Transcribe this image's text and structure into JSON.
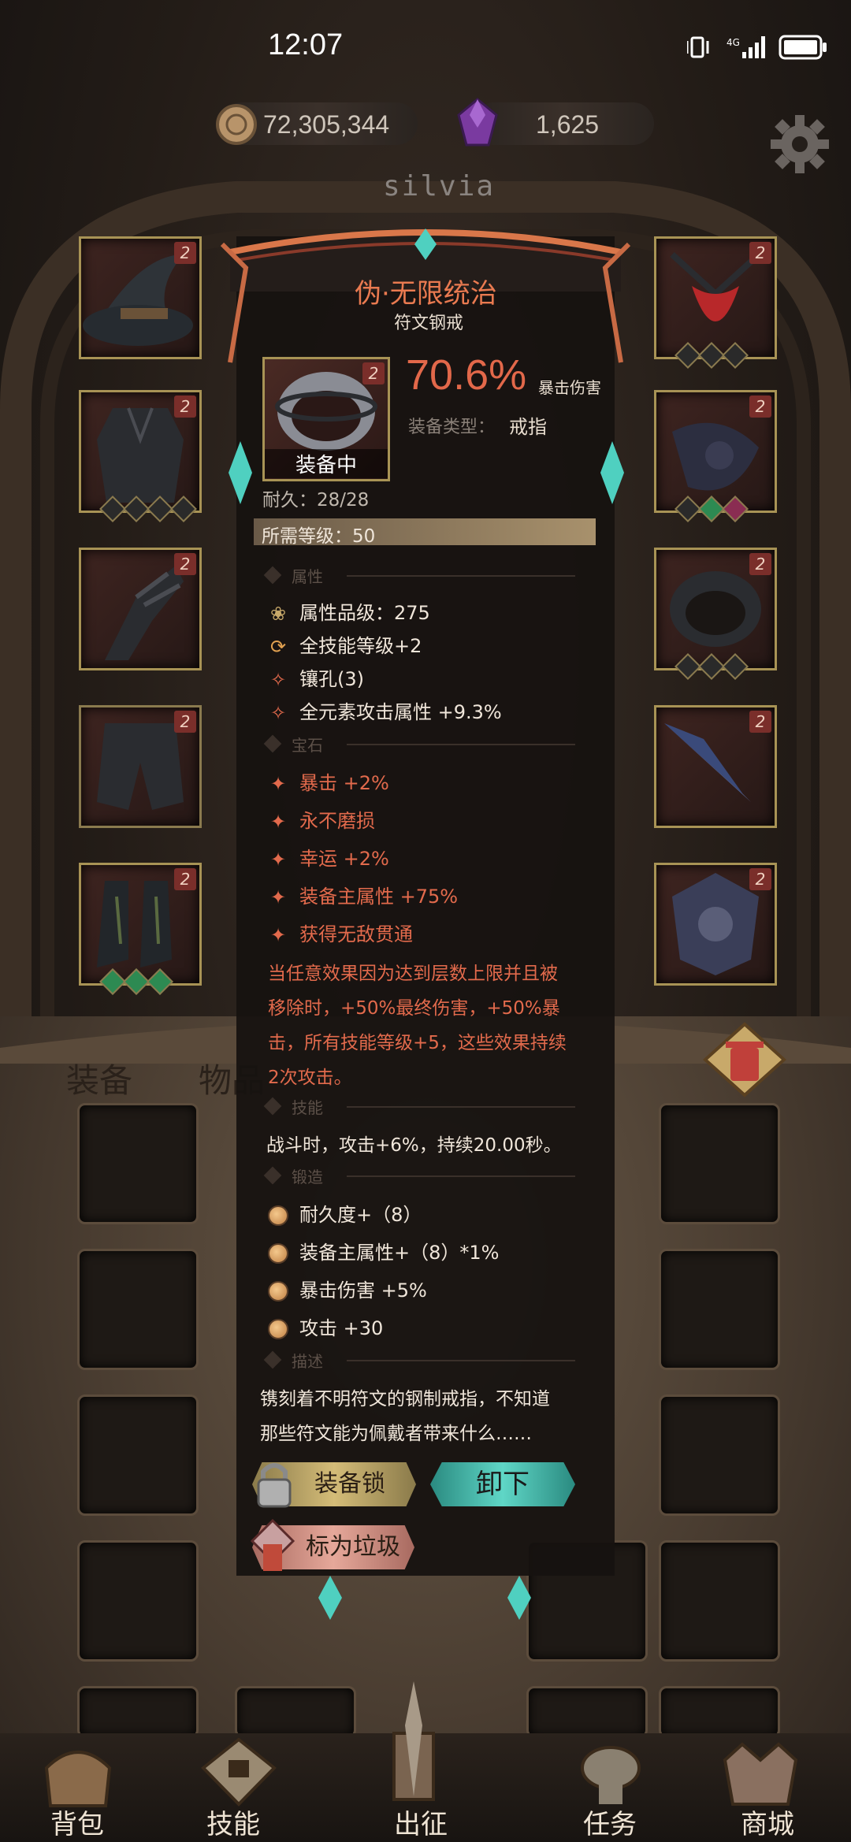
{
  "status_bar": {
    "time": "12:07",
    "network": "4G",
    "icons": [
      "vibrate-icon",
      "signal-icon",
      "battery-icon"
    ]
  },
  "currency": {
    "gold": "72,305,344",
    "gems": "1,625"
  },
  "settings_icon": "gear-icon",
  "character_name": "silvia",
  "equip_slots_left": [
    {
      "name": "hat",
      "rank": "2"
    },
    {
      "name": "armor",
      "rank": "2"
    },
    {
      "name": "gloves",
      "rank": "2"
    },
    {
      "name": "pants",
      "rank": "2"
    },
    {
      "name": "boots",
      "rank": "2"
    }
  ],
  "equip_slots_right": [
    {
      "name": "amulet",
      "rank": "2"
    },
    {
      "name": "weapon-offhand",
      "rank": "2"
    },
    {
      "name": "ring",
      "rank": "2"
    },
    {
      "name": "weapon",
      "rank": "2"
    },
    {
      "name": "shield",
      "rank": "2"
    }
  ],
  "item": {
    "title": "伪·无限统治",
    "subtitle": "符文钢戒",
    "rank": "2",
    "equipped_label": "装备中",
    "main_value": "70.6%",
    "main_stat": "暴击伤害",
    "type_label": "装备类型：",
    "type_value": "戒指",
    "durability": "耐久：28/28",
    "required_level": "所需等级：50",
    "sections": {
      "attributes": "属性",
      "gems": "宝石",
      "skills": "技能",
      "forge": "锻造",
      "description": "描述"
    },
    "attributes": [
      "属性品级：275",
      "全技能等级+2",
      "镶孔(3)",
      "全元素攻击属性 +9.3%"
    ],
    "gems": [
      "暴击 +2%",
      "永不磨损",
      "幸运 +2%",
      "装备主属性 +75%",
      "获得无敌贯通"
    ],
    "gem_effect_lines": [
      "当任意效果因为达到层数上限并且被",
      "移除时，+50%最终伤害，+50%暴",
      "击，所有技能等级+5，这些效果持续",
      "2次攻击。"
    ],
    "skill": "战斗时，攻击+6%，持续20.00秒。",
    "forge": [
      "耐久度+（8）",
      "装备主属性+（8）*1%",
      "暴击伤害 +5%",
      "攻击 +30"
    ],
    "description_lines": [
      "镌刻着不明符文的钢制戒指，不知道",
      "那些符文能为佩戴者带来什么……"
    ]
  },
  "buttons": {
    "lock": "装备锁",
    "unequip": "卸下",
    "mark_junk": "标为垃圾"
  },
  "bag_tabs": {
    "equipment": "装备",
    "items": "物品"
  },
  "nav": [
    "背包",
    "技能",
    "出征",
    "任务",
    "商城"
  ],
  "colors": {
    "accent_red": "#e26a4c",
    "teal": "#3fb8a8",
    "gold": "#c8a96a"
  }
}
